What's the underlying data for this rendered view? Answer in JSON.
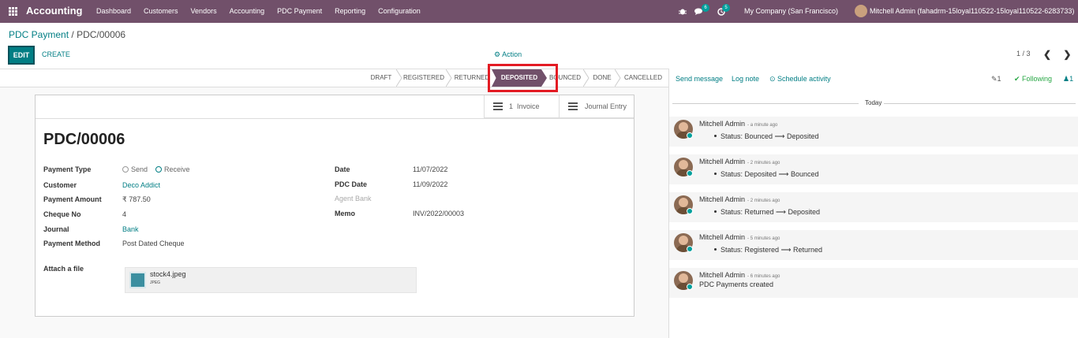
{
  "navbar": {
    "brand": "Accounting",
    "menu": [
      "Dashboard",
      "Customers",
      "Vendors",
      "Accounting",
      "PDC Payment",
      "Reporting",
      "Configuration"
    ],
    "messages_count": "6",
    "activities_count": "5",
    "company": "My Company (San Francisco)",
    "user": "Mitchell Admin (fahadrm-15loyal110522-15loyal110522-6283733)"
  },
  "breadcrumb": {
    "parent": "PDC Payment",
    "separator": "/",
    "current": "PDC/00006"
  },
  "controls": {
    "edit": "EDIT",
    "create": "CREATE",
    "action": "⚙ Action",
    "pager": "1 / 3",
    "prev": "❮",
    "next": "❯"
  },
  "statusbar": {
    "stages": [
      "DRAFT",
      "REGISTERED",
      "RETURNED",
      "DEPOSITED",
      "BOUNCED",
      "DONE",
      "CANCELLED"
    ],
    "active": "DEPOSITED"
  },
  "smart_buttons": {
    "invoice_count": "1",
    "invoice_label": "Invoice",
    "journal_label": "Journal Entry"
  },
  "record": {
    "title": "PDC/00006",
    "left": [
      {
        "label": "Payment Type",
        "value": ""
      },
      {
        "label": "Customer",
        "value": "Deco Addict"
      },
      {
        "label": "Payment Amount",
        "value": "₹ 787.50"
      },
      {
        "label": "Cheque No",
        "value": "4"
      },
      {
        "label": "Journal",
        "value": "Bank"
      },
      {
        "label": "Payment Method",
        "value": "Post Dated Cheque"
      }
    ],
    "payment_type_options": [
      "Send",
      "Receive"
    ],
    "payment_type_selected": "Receive",
    "right": [
      {
        "label": "Date",
        "value": "11/07/2022"
      },
      {
        "label": "PDC Date",
        "value": "11/09/2022"
      },
      {
        "label": "Agent Bank",
        "value": ""
      },
      {
        "label": "Memo",
        "value": "INV/2022/00003"
      }
    ],
    "attach_label": "Attach a file",
    "attachment": {
      "name": "stock4.jpeg",
      "ext": "JPEG"
    }
  },
  "chatter": {
    "send_message": "Send message",
    "log_note": "Log note",
    "schedule_activity": "⊙ Schedule activity",
    "attachments_count": "1",
    "following": "✔ Following",
    "followers_count": "1",
    "day": "Today",
    "messages": [
      {
        "author": "Mitchell Admin",
        "time": "- a minute ago",
        "body": "Status: Bounced ⟶ Deposited"
      },
      {
        "author": "Mitchell Admin",
        "time": "- 2 minutes ago",
        "body": "Status: Deposited ⟶ Bounced"
      },
      {
        "author": "Mitchell Admin",
        "time": "- 2 minutes ago",
        "body": "Status: Returned ⟶ Deposited"
      },
      {
        "author": "Mitchell Admin",
        "time": "- 5 minutes ago",
        "body": "Status: Registered ⟶ Returned"
      },
      {
        "author": "Mitchell Admin",
        "time": "- 6 minutes ago",
        "body": "PDC Payments created"
      }
    ]
  },
  "colors": {
    "brand": "#71506a",
    "accent": "#017e84",
    "highlight": "#e31b23",
    "online": "#00a09d"
  }
}
